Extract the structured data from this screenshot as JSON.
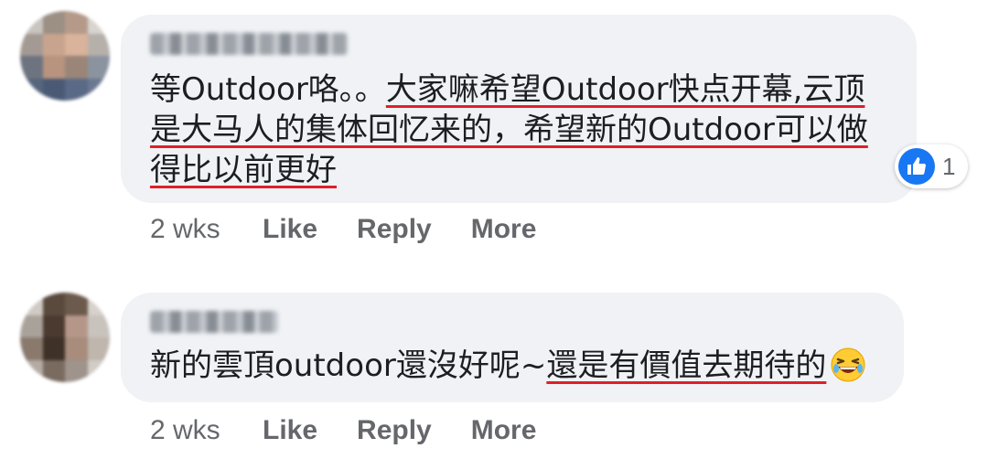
{
  "comments": [
    {
      "author": "",
      "text_plain": "等Outdoor咯。。",
      "text_underlined_1": "大家嘛希望Outdoor快点开幕,云顶",
      "text_underlined_2": "是大马人的集体回忆来的，希望新的Outdoor可以做",
      "text_underlined_3": "得比以前更好",
      "time": "2 wks",
      "actions": {
        "like": "Like",
        "reply": "Reply",
        "more": "More"
      },
      "reactions": {
        "icon": "like-icon",
        "count": "1"
      }
    },
    {
      "author": "",
      "text_plain": "新的雲頂outdoor還沒好呢~",
      "text_underlined": "還是有價值去期待的",
      "emoji": "laughing-emoji",
      "time": "2 wks",
      "actions": {
        "like": "Like",
        "reply": "Reply",
        "more": "More"
      }
    }
  ],
  "colors": {
    "bubble": "#f0f2f5",
    "underline": "#e0202a",
    "like_blue": "#1877f2",
    "meta": "#65676b"
  }
}
